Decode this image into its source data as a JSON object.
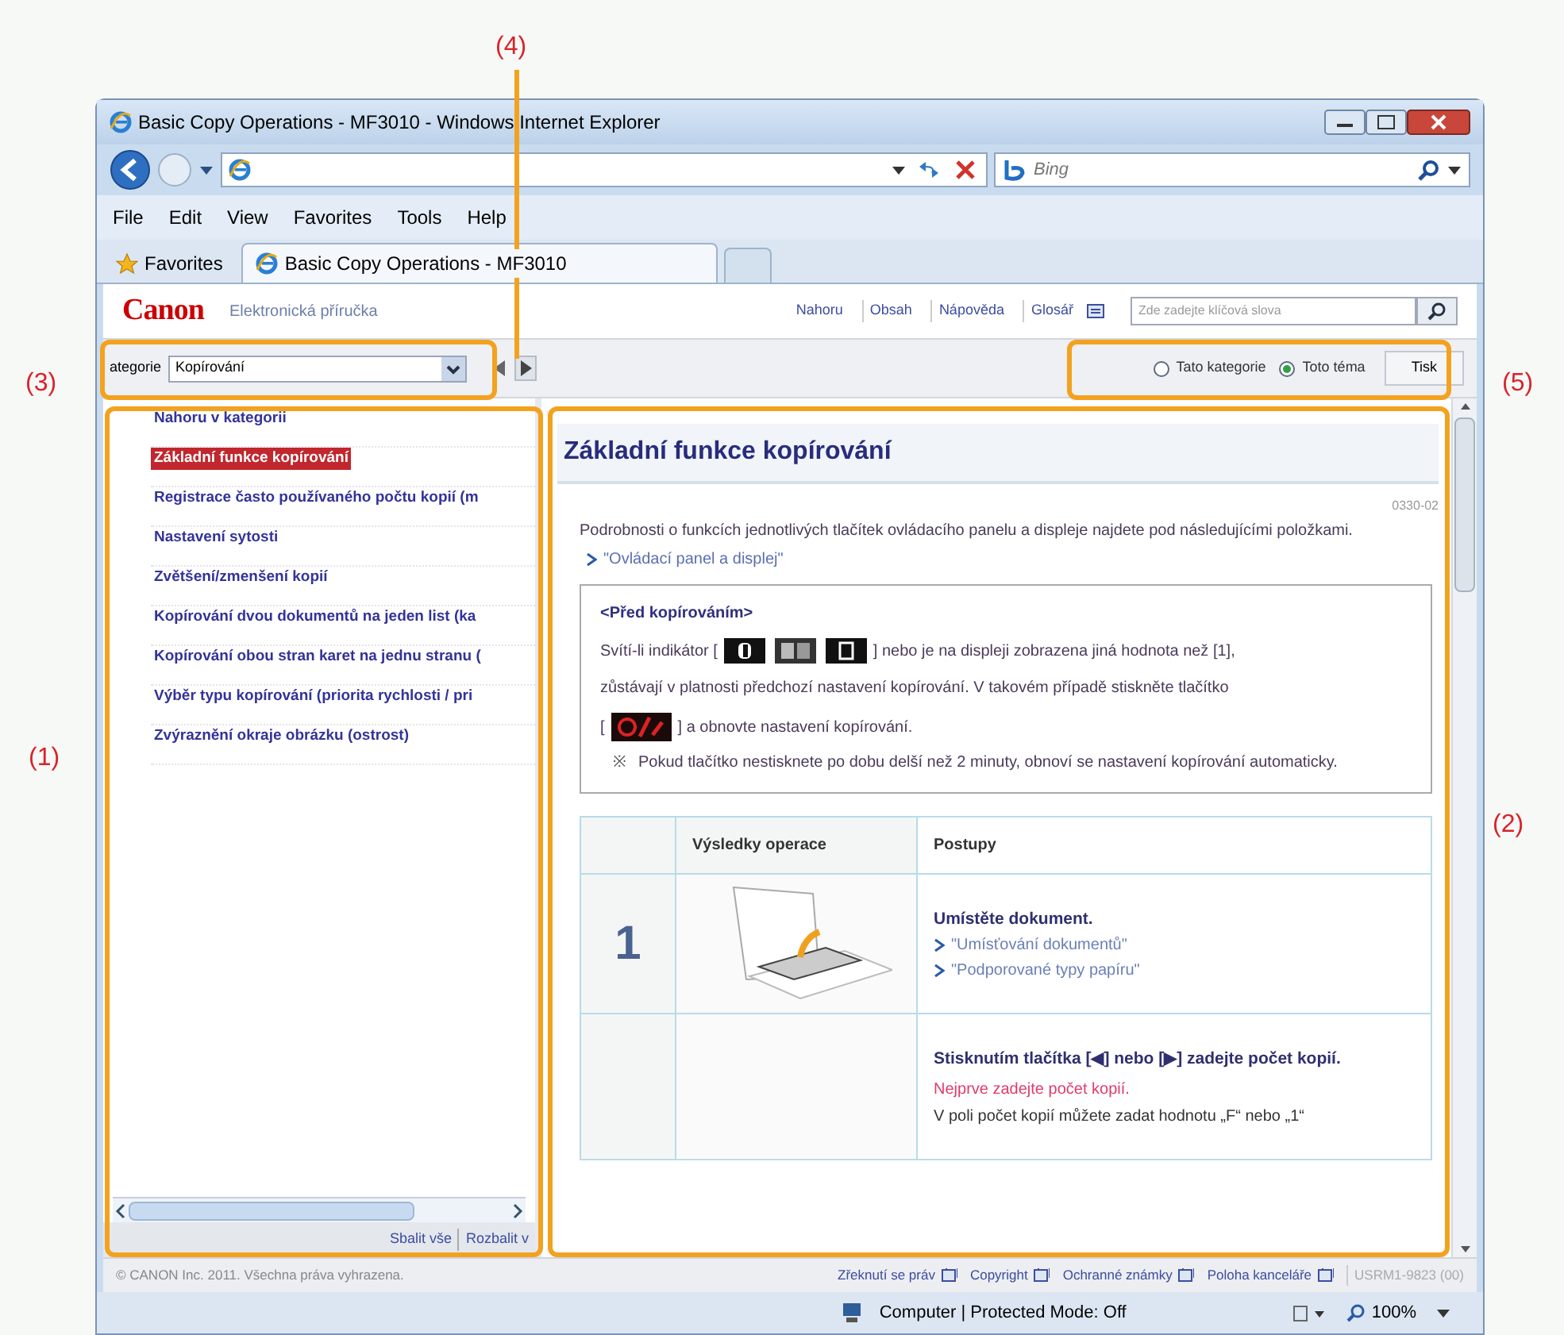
{
  "callouts": [
    {
      "label": "(4)",
      "kind": "line"
    },
    {
      "label": "(3)",
      "kind": "category"
    },
    {
      "label": "(5)",
      "kind": "search-scope"
    },
    {
      "label": "(1)",
      "kind": "nav"
    },
    {
      "label": "(2)",
      "kind": "article"
    }
  ],
  "window": {
    "title": "Basic Copy Operations - MF3010 - Windows Internet Explorer"
  },
  "address_bar": {
    "search_placeholder": "Bing"
  },
  "menu": [
    "File",
    "Edit",
    "View",
    "Favorites",
    "Tools",
    "Help"
  ],
  "favorites": {
    "label": "Favorites"
  },
  "tabs": [
    {
      "label": "Basic Copy Operations - MF3010",
      "selected": true
    }
  ],
  "header": {
    "logo": "Canon",
    "subtitle": "Elektronická příručka",
    "links": [
      "Nahoru",
      "Obsah",
      "Nápověda",
      "Glosář"
    ],
    "search_placeholder": "Zde zadejte klíčová slova"
  },
  "toolbar": {
    "category_label": "ategorie",
    "category_value": "Kopírování",
    "scopes": [
      {
        "label": "Tato kategorie",
        "selected": false
      },
      {
        "label": "Toto téma",
        "selected": true
      }
    ],
    "print": "Tisk"
  },
  "nav": {
    "items": [
      {
        "label": "Nahoru v kategorii",
        "selected": false
      },
      {
        "label": "Základní funkce kopírování",
        "selected": true
      },
      {
        "label": "Registrace často používaného počtu kopií (m",
        "selected": false
      },
      {
        "label": "Nastavení sytosti",
        "selected": false
      },
      {
        "label": "Zvětšení/zmenšení kopií",
        "selected": false
      },
      {
        "label": "Kopírování dvou dokumentů na jeden list (ka",
        "selected": false
      },
      {
        "label": "Kopírování obou stran karet na jednu stranu (",
        "selected": false
      },
      {
        "label": "Výběr typu kopírování (priorita rychlosti / pri",
        "selected": false
      },
      {
        "label": "Zvýraznění okraje obrázku (ostrost)",
        "selected": false
      }
    ],
    "collapse": "Sbalit vše",
    "expand": "Rozbalit v"
  },
  "article": {
    "title": "Základní funkce kopírování",
    "code": "0330-02",
    "intro": "Podrobnosti o funkcích jednotlivých tlačítek ovládacího panelu a displeje najdete pod následujícími položkami.",
    "intro_link": "\"Ovládací panel a displej\"",
    "note": {
      "heading": "<Před kopírováním>",
      "lines": [
        [
          {
            "kind": "text",
            "text": "Svítí-li indikátor ["
          },
          {
            "kind": "indicator_icons"
          },
          {
            "kind": "text",
            "text": "] nebo je na displeji zobrazena jiná hodnota než [1],"
          }
        ],
        [
          {
            "kind": "text",
            "text": "zůstávají v platnosti předchozí nastavení kopírování. V takovém případě stiskněte tlačítko"
          }
        ],
        [
          {
            "kind": "text",
            "text": "["
          },
          {
            "kind": "reset_icon"
          },
          {
            "kind": "text",
            "text": "] a obnovte nastavení kopírování."
          }
        ]
      ],
      "mark": "※",
      "remark": "Pokud tlačítko nestisknete po dobu delší než 2 minuty, obnoví se nastavení kopírování automaticky."
    },
    "table": {
      "columns": [
        "Výsledky operace",
        "Postupy"
      ],
      "rows": [
        {
          "step": "1",
          "illustration": true,
          "heading": "Umístěte dokument.",
          "links": [
            "\"Umísťování dokumentů\"",
            "\"Podporované typy papíru\""
          ]
        },
        {
          "illustration": false,
          "heading": "Stisknutím tlačítka [◀] nebo [▶] zadejte počet kopií.",
          "warning": "Nejprve zadejte počet kopií.",
          "text": "V poli počet kopií můžete zadat hodnotu „F“ nebo „1“"
        }
      ]
    }
  },
  "footer": {
    "copyright": "© CANON Inc. 2011. Všechna práva vyhrazena.",
    "links": [
      "Zřeknutí se práv",
      "Copyright",
      "Ochranné známky",
      "Poloha kanceláře"
    ],
    "code": "USRM1-9823 (00)"
  },
  "status_bar": {
    "zone": "Computer | Protected Mode: Off",
    "zoom": "100%"
  }
}
